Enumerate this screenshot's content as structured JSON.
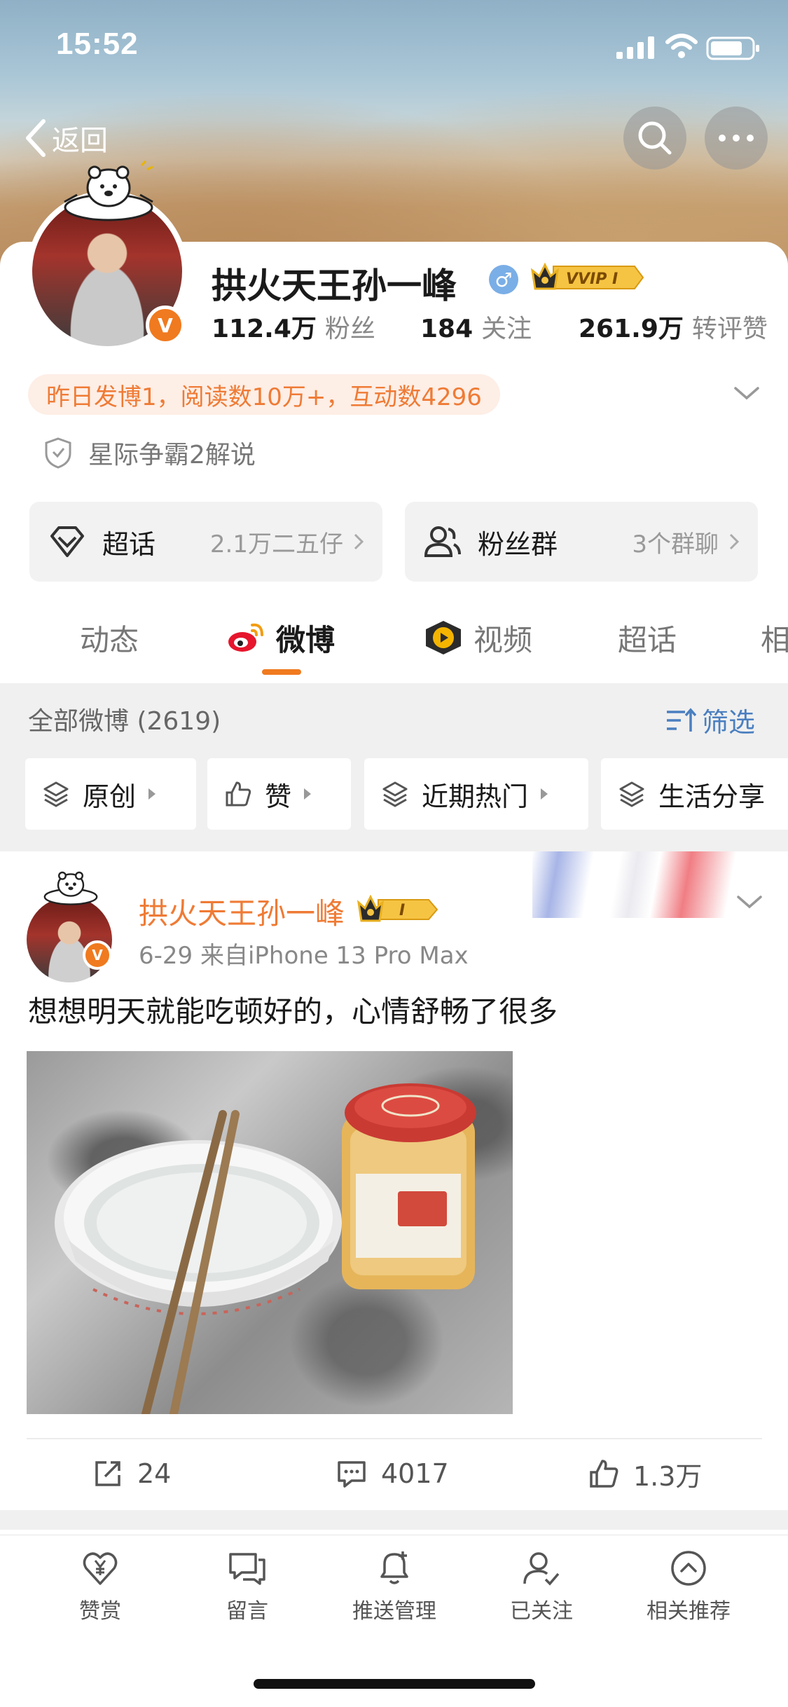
{
  "status_bar": {
    "time": "15:52"
  },
  "nav": {
    "back_label": "返回"
  },
  "profile": {
    "username": "拱火天王孙一峰",
    "gender_symbol": "♂",
    "vip_label": "VVIP I",
    "verified_mark": "V",
    "stats": {
      "followers_value": "112.4万",
      "followers_label": "粉丝",
      "following_value": "184",
      "following_label": "关注",
      "reposts_value": "261.9万",
      "reposts_label": "转评赞"
    },
    "activity_summary": "昨日发博1，阅读数10万+，互动数4296",
    "certification": "星际争霸2解说"
  },
  "entry_cards": {
    "supertopic": {
      "label": "超话",
      "detail": "2.1万二五仔"
    },
    "fangroup": {
      "label": "粉丝群",
      "detail": "3个群聊"
    }
  },
  "tabs": [
    {
      "label": "动态"
    },
    {
      "label": "微博"
    },
    {
      "label": "视频"
    },
    {
      "label": "超话"
    },
    {
      "label": "相"
    }
  ],
  "filter": {
    "all_label": "全部微博 (2619)",
    "filter_label": "筛选",
    "chips": [
      {
        "label": "原创"
      },
      {
        "label": "赞"
      },
      {
        "label": "近期热门"
      },
      {
        "label": "生活分享"
      }
    ]
  },
  "post": {
    "author": "拱火天王孙一峰",
    "vip_label": "I",
    "meta": "6-29  来自iPhone 13 Pro Max",
    "text": "想想明天就能吃顿好的，心情舒畅了很多",
    "actions": {
      "reposts": "24",
      "comments": "4017",
      "likes": "1.3万"
    }
  },
  "bottom_bar": [
    {
      "label": "赞赏",
      "icon": "heart-yen-icon"
    },
    {
      "label": "留言",
      "icon": "message-icon"
    },
    {
      "label": "推送管理",
      "icon": "bell-plus-icon"
    },
    {
      "label": "已关注",
      "icon": "user-check-icon"
    },
    {
      "label": "相关推荐",
      "icon": "chevron-up-circle-icon"
    }
  ],
  "colors": {
    "accent_orange": "#f07a1f",
    "link_blue": "#4a7fc0",
    "pill_bg": "#fdeee6"
  }
}
